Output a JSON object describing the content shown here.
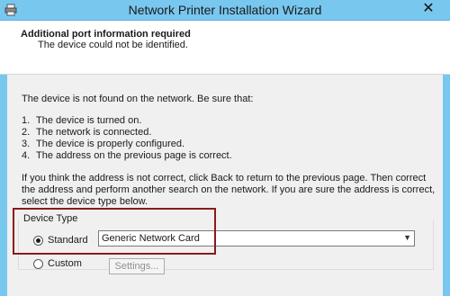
{
  "window": {
    "title": "Network Printer Installation Wizard",
    "close_glyph": "✕",
    "icon": "printer-icon"
  },
  "header": {
    "title": "Additional port information required",
    "subtitle": "The device could not be identified."
  },
  "content": {
    "intro": "The device is not found on the network.  Be sure that:",
    "checklist": [
      {
        "num": "1.",
        "text": "The device is turned on."
      },
      {
        "num": "2.",
        "text": "The network is connected."
      },
      {
        "num": "3.",
        "text": "The device is properly configured."
      },
      {
        "num": "4.",
        "text": "The address on the previous page is correct."
      }
    ],
    "instructions": "If you think the address is not correct, click Back to return to the previous page.  Then correct the address and perform another search on the network.  If you are sure the address is correct, select the device type below."
  },
  "device_type": {
    "group_label": "Device Type",
    "standard": {
      "label": "Standard",
      "selected": true
    },
    "standard_select": {
      "value": "Generic Network Card"
    },
    "custom": {
      "label": "Custom",
      "selected": false
    },
    "settings_label": "Settings..."
  },
  "colors": {
    "titlebar": "#78c7ef",
    "highlight_box": "#8b1a1a",
    "content_bg": "#f0f0f0"
  }
}
